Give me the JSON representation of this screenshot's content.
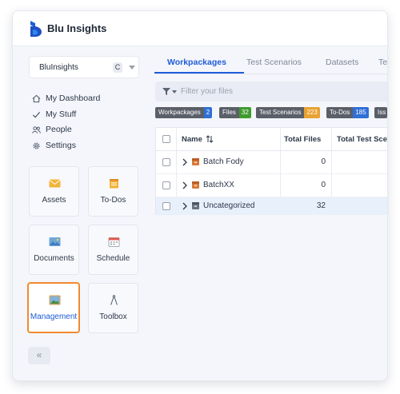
{
  "app": {
    "title": "Blu Insights"
  },
  "workspace": {
    "name": "BluInsights",
    "badge": "C"
  },
  "nav": [
    {
      "label": "My Dashboard",
      "icon": "home-icon"
    },
    {
      "label": "My Stuff",
      "icon": "check-icon"
    },
    {
      "label": "People",
      "icon": "people-icon"
    },
    {
      "label": "Settings",
      "icon": "gear-icon"
    }
  ],
  "tiles": [
    {
      "label": "Assets",
      "icon": "envelope-icon"
    },
    {
      "label": "To-Dos",
      "icon": "notepad-icon"
    },
    {
      "label": "Documents",
      "icon": "image-icon"
    },
    {
      "label": "Schedule",
      "icon": "calendar-icon"
    },
    {
      "label": "Management",
      "icon": "painting-icon",
      "active": true
    },
    {
      "label": "Toolbox",
      "icon": "compass-icon"
    }
  ],
  "collapse_label": "«",
  "tabs": [
    "Workpackages",
    "Test Scenarios",
    "Datasets",
    "Te"
  ],
  "active_tab": "Workpackages",
  "tab_more": "›",
  "filter": {
    "placeholder": "Filter your files",
    "value": ""
  },
  "chips": [
    {
      "label": "Workpackages",
      "count": "2",
      "color": "#2f6fd6"
    },
    {
      "label": "Files",
      "count": "32",
      "color": "#3f9b2f"
    },
    {
      "label": "Test Scenarios",
      "count": "223",
      "color": "#e8a231"
    },
    {
      "label": "To-Dos",
      "count": "185",
      "color": "#2f6fd6"
    },
    {
      "label": "Iss",
      "count": "",
      "color": "#5a5f68"
    }
  ],
  "table": {
    "columns": [
      "Name",
      "Total Files",
      "Total Test Scen"
    ],
    "rows": [
      {
        "name": "Batch Fody",
        "total_files": "0"
      },
      {
        "name": "BatchXX",
        "total_files": "0"
      },
      {
        "name": "Uncategorized",
        "total_files": "32"
      }
    ]
  },
  "colors": {
    "accent": "#1e5bd8",
    "active_tile_border": "#f28a2e",
    "package_icon": "#d77a3a"
  }
}
